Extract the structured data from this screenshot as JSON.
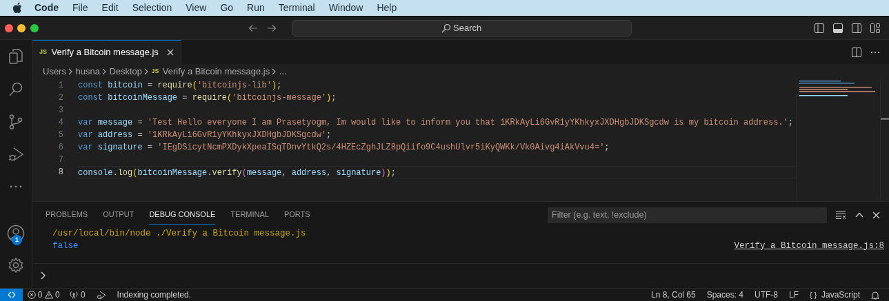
{
  "menu_bar": {
    "app": "Code",
    "items": [
      "File",
      "Edit",
      "Selection",
      "View",
      "Go",
      "Run",
      "Terminal",
      "Window",
      "Help"
    ]
  },
  "title_bar": {
    "search": {
      "placeholder": "Search"
    }
  },
  "tabs": [
    {
      "icon_text": "JS",
      "label": "Verify a Bitcoin message.js",
      "selected": true
    }
  ],
  "breadcrumb": [
    {
      "label": "Users"
    },
    {
      "label": "husna"
    },
    {
      "label": "Desktop"
    },
    {
      "label": "Verify a Bitcoin message.js",
      "icon_text": "JS"
    },
    {
      "label": "..."
    }
  ],
  "editor": {
    "lines": [
      {
        "number": "1",
        "current": false,
        "tokens": [
          {
            "kind": "kw",
            "text": "const "
          },
          {
            "kind": "var",
            "text": "bitcoin"
          },
          {
            "kind": "plain",
            "text": " = "
          },
          {
            "kind": "fn",
            "text": "require"
          },
          {
            "kind": "brk1",
            "text": "("
          },
          {
            "kind": "str",
            "text": "'bitcoinjs-lib'"
          },
          {
            "kind": "brk1",
            "text": ")"
          },
          {
            "kind": "plain",
            "text": ";"
          }
        ]
      },
      {
        "number": "2",
        "current": false,
        "tokens": [
          {
            "kind": "kw",
            "text": "const "
          },
          {
            "kind": "var",
            "text": "bitcoinMessage"
          },
          {
            "kind": "plain",
            "text": " = "
          },
          {
            "kind": "fn",
            "text": "require"
          },
          {
            "kind": "brk1",
            "text": "("
          },
          {
            "kind": "str",
            "text": "'bitcoinjs-message'"
          },
          {
            "kind": "brk1",
            "text": ")"
          },
          {
            "kind": "plain",
            "text": ";"
          }
        ]
      },
      {
        "number": "3",
        "current": false
      },
      {
        "number": "4",
        "current": false,
        "tokens": [
          {
            "kind": "kw",
            "text": "var "
          },
          {
            "kind": "var",
            "text": "message"
          },
          {
            "kind": "plain",
            "text": " = "
          },
          {
            "kind": "str",
            "text": "'Test Hello everyone I am Prasetyogm, Im would like to inform you that 1KRkAyLi6GvR1yYKhkyxJXDHgbJDKSgcdw is my bitcoin address.'"
          },
          {
            "kind": "plain",
            "text": ";"
          }
        ]
      },
      {
        "number": "5",
        "current": false,
        "tokens": [
          {
            "kind": "kw",
            "text": "var "
          },
          {
            "kind": "var",
            "text": "address"
          },
          {
            "kind": "plain",
            "text": " = "
          },
          {
            "kind": "str",
            "text": "'1KRkAyLi6GvR1yYKhkyxJXDHgbJDKSgcdw'"
          },
          {
            "kind": "plain",
            "text": ";"
          }
        ]
      },
      {
        "number": "6",
        "current": false,
        "tokens": [
          {
            "kind": "kw",
            "text": "var "
          },
          {
            "kind": "var",
            "text": "signature"
          },
          {
            "kind": "plain",
            "text": " = "
          },
          {
            "kind": "str",
            "text": "'IEgDSicytNcmPXDykXpeaISqTDnvYtkQ2s/4HZEcZghJLZ8pQiifo9C4ushUlvr5iKyQWKk/Vk0Aivg4iAkVvu4='"
          },
          {
            "kind": "plain",
            "text": ";"
          }
        ]
      },
      {
        "number": "7",
        "current": false
      },
      {
        "number": "8",
        "current": true,
        "tokens": [
          {
            "kind": "var",
            "text": "console"
          },
          {
            "kind": "plain",
            "text": "."
          },
          {
            "kind": "fn",
            "text": "log"
          },
          {
            "kind": "brk1",
            "text": "("
          },
          {
            "kind": "var",
            "text": "bitcoinMessage"
          },
          {
            "kind": "plain",
            "text": "."
          },
          {
            "kind": "fn",
            "text": "verify"
          },
          {
            "kind": "brk2",
            "text": "("
          },
          {
            "kind": "var",
            "text": "message"
          },
          {
            "kind": "plain",
            "text": ", "
          },
          {
            "kind": "var",
            "text": "address"
          },
          {
            "kind": "plain",
            "text": ", "
          },
          {
            "kind": "var",
            "text": "signature"
          },
          {
            "kind": "brk2",
            "text": ")"
          },
          {
            "kind": "brk1",
            "text": ")"
          },
          {
            "kind": "plain",
            "text": ";"
          }
        ]
      }
    ]
  },
  "activity_bar": {
    "account_badge": "1"
  },
  "panel": {
    "tabs": [
      {
        "label": "PROBLEMS",
        "selected": false
      },
      {
        "label": "OUTPUT",
        "selected": false
      },
      {
        "label": "DEBUG CONSOLE",
        "selected": true
      },
      {
        "label": "TERMINAL",
        "selected": false
      },
      {
        "label": "PORTS",
        "selected": false
      }
    ],
    "filter": {
      "placeholder": "Filter (e.g. text, !exclude)"
    },
    "output": [
      {
        "kind": "command",
        "text": "/usr/local/bin/node ./Verify a Bitcoin message.js"
      },
      {
        "kind": "value",
        "text": "false",
        "source": "Verify a Bitcoin message.js:8"
      }
    ]
  },
  "status_bar": {
    "errors": "0",
    "warnings": "0",
    "ports": "0",
    "message": "Indexing completed.",
    "position": "Ln 8, Col 65",
    "spaces": "Spaces: 4",
    "encoding": "UTF-8",
    "eol": "LF",
    "language_icon": "{ }",
    "language": "JavaScript"
  }
}
